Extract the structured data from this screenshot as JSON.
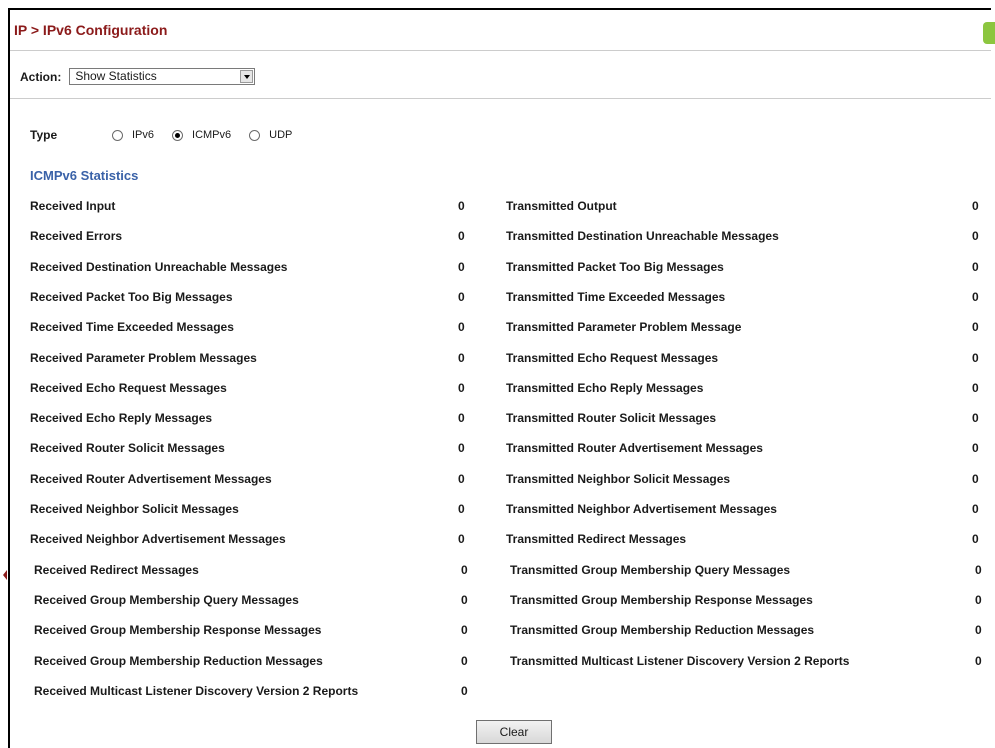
{
  "header": {
    "title": "IP > IPv6 Configuration"
  },
  "action": {
    "label": "Action:",
    "value": "Show Statistics"
  },
  "type": {
    "label": "Type",
    "options": [
      {
        "label": "IPv6",
        "checked": false
      },
      {
        "label": "ICMPv6",
        "checked": true
      },
      {
        "label": "UDP",
        "checked": false
      }
    ]
  },
  "section": {
    "title": "ICMPv6 Statistics"
  },
  "stats": {
    "rows": [
      {
        "left": "Received Input",
        "left_value": "0",
        "right": "Transmitted Output",
        "right_value": "0"
      },
      {
        "left": "Received Errors",
        "left_value": "0",
        "right": "Transmitted Destination Unreachable Messages",
        "right_value": "0"
      },
      {
        "left": "Received Destination Unreachable Messages",
        "left_value": "0",
        "right": "Transmitted Packet Too Big Messages",
        "right_value": "0"
      },
      {
        "left": "Received Packet Too Big Messages",
        "left_value": "0",
        "right": "Transmitted Time Exceeded Messages",
        "right_value": "0"
      },
      {
        "left": "Received Time Exceeded Messages",
        "left_value": "0",
        "right": "Transmitted Parameter Problem Message",
        "right_value": "0"
      },
      {
        "left": "Received Parameter Problem Messages",
        "left_value": "0",
        "right": "Transmitted Echo Request Messages",
        "right_value": "0"
      },
      {
        "left": "Received Echo Request Messages",
        "left_value": "0",
        "right": "Transmitted Echo Reply Messages",
        "right_value": "0"
      },
      {
        "left": "Received Echo Reply Messages",
        "left_value": "0",
        "right": "Transmitted Router Solicit Messages",
        "right_value": "0"
      },
      {
        "left": "Received Router Solicit Messages",
        "left_value": "0",
        "right": "Transmitted Router Advertisement Messages",
        "right_value": "0"
      },
      {
        "left": "Received Router Advertisement Messages",
        "left_value": "0",
        "right": "Transmitted Neighbor Solicit Messages",
        "right_value": "0"
      },
      {
        "left": "Received Neighbor Solicit Messages",
        "left_value": "0",
        "right": "Transmitted Neighbor Advertisement Messages",
        "right_value": "0"
      },
      {
        "left": "Received Neighbor Advertisement Messages",
        "left_value": "0",
        "right": "Transmitted Redirect Messages",
        "right_value": "0"
      },
      {
        "left": "Received Redirect Messages",
        "left_value": "0",
        "right": "Transmitted Group Membership Query Messages",
        "right_value": "0"
      },
      {
        "left": "Received Group Membership Query Messages",
        "left_value": "0",
        "right": "Transmitted Group Membership Response Messages",
        "right_value": "0"
      },
      {
        "left": "Received Group Membership Response Messages",
        "left_value": "0",
        "right": "Transmitted Group Membership Reduction Messages",
        "right_value": "0"
      },
      {
        "left": "Received Group Membership Reduction Messages",
        "left_value": "0",
        "right": "Transmitted Multicast Listener Discovery Version 2 Reports",
        "right_value": "0"
      },
      {
        "left": "Received Multicast Listener Discovery Version 2 Reports",
        "left_value": "0",
        "right": "",
        "right_value": ""
      }
    ]
  },
  "buttons": {
    "clear_label": "Clear"
  }
}
